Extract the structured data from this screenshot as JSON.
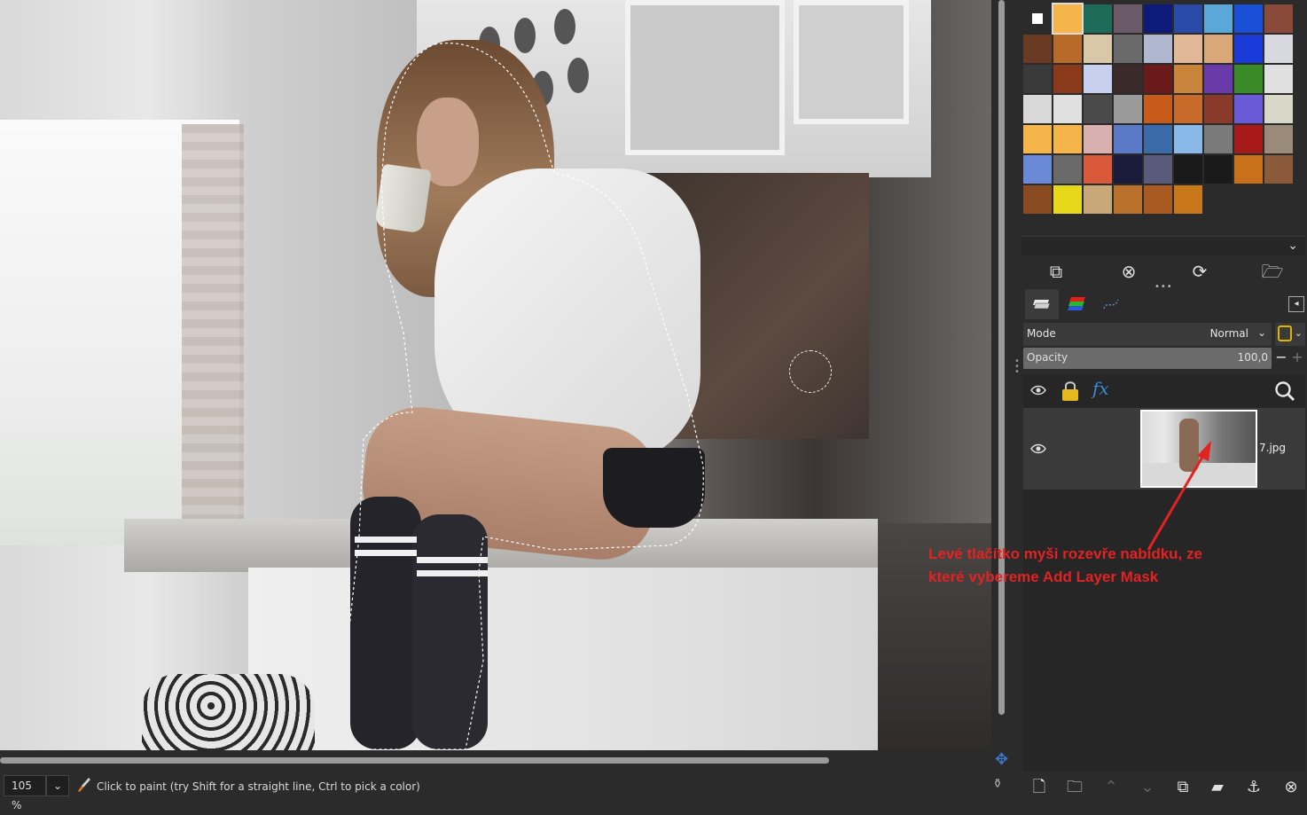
{
  "canvas": {
    "image_description_alt": ""
  },
  "statusbar": {
    "zoom": "105 %",
    "zoom_dropdown": "⌄",
    "message": "Click to paint (try Shift for a straight line, Ctrl to pick a color)"
  },
  "patterns": {
    "colors": [
      "#ffffff",
      "#f6b54a",
      "#1d6a58",
      "#6b5a6a",
      "#0d1a7a",
      "#2a4aa8",
      "#5aa8d8",
      "#1a4fd8",
      "#8a4a3a",
      "#6a3a22",
      "#b86a2a",
      "#d8c8a8",
      "#6a6a6a",
      "#b0b8d0",
      "#e0b898",
      "#d8a878",
      "#1a3ad8",
      "#d8d8e0",
      "#3a3a3a",
      "#8a3a1a",
      "#c8d0f0",
      "#3a2a2a",
      "#6a1a1a",
      "#c8843a",
      "#6a3aa8",
      "#3a8a2a",
      "#e0e0e0",
      "#d8d8d8",
      "#e0e0e0",
      "#4a4a4a",
      "#9a9a9a",
      "#c85a1a",
      "#c86a2a",
      "#8a3a2a",
      "#6a5ad8",
      "#d8d8c8",
      "#f6b54a",
      "#f6b54a",
      "#d8b0b0",
      "#5a7ac8",
      "#3a6aa8",
      "#8ab8e8",
      "#7a7a7a",
      "#a81a1a",
      "#9a8a7a",
      "#6a8ad8",
      "#6a6a6a",
      "#d85a3a",
      "#1a1a3a",
      "#5a5a7a",
      "#1a1a1a",
      "#1a1a1a",
      "#c8701a",
      "#8a5a3a",
      "#8a4a22",
      "#e8d81a",
      "#c8a878",
      "#b8702a",
      "#a85a22",
      "#c8781a"
    ]
  },
  "patterns_menu_chevron": "⌄",
  "pattern_actions": {
    "duplicate": "⧉",
    "delete": "⊗",
    "refresh": "⟳",
    "open": "🗁"
  },
  "tabs": {
    "menu": "◂"
  },
  "layers": {
    "mode_label": "Mode",
    "mode_value": "Normal",
    "mode_chevron": "⌄",
    "mode_switch_chevron": "⌄",
    "opacity_label": "Opacity",
    "opacity_value": "100,0",
    "opacity_fraction": 1.0,
    "opacity_minus": "−",
    "opacity_plus": "+",
    "fx_label": "fx",
    "layer_name": "7.jpg"
  },
  "layer_actions": {
    "new_layer": "🗋",
    "new_group": "🗀",
    "raise": "⌃",
    "lower": "⌄",
    "duplicate": "⧉",
    "merge": "▰",
    "anchor": "⚓",
    "delete": "⊗"
  },
  "annotation": {
    "line1": "Levé tlačítko myši rozevře nabídku, ze",
    "line2": "které vybereme Add Layer Mask",
    "color": "#e32222"
  },
  "icons": {
    "nav": "✥",
    "status_right": "⚱"
  }
}
